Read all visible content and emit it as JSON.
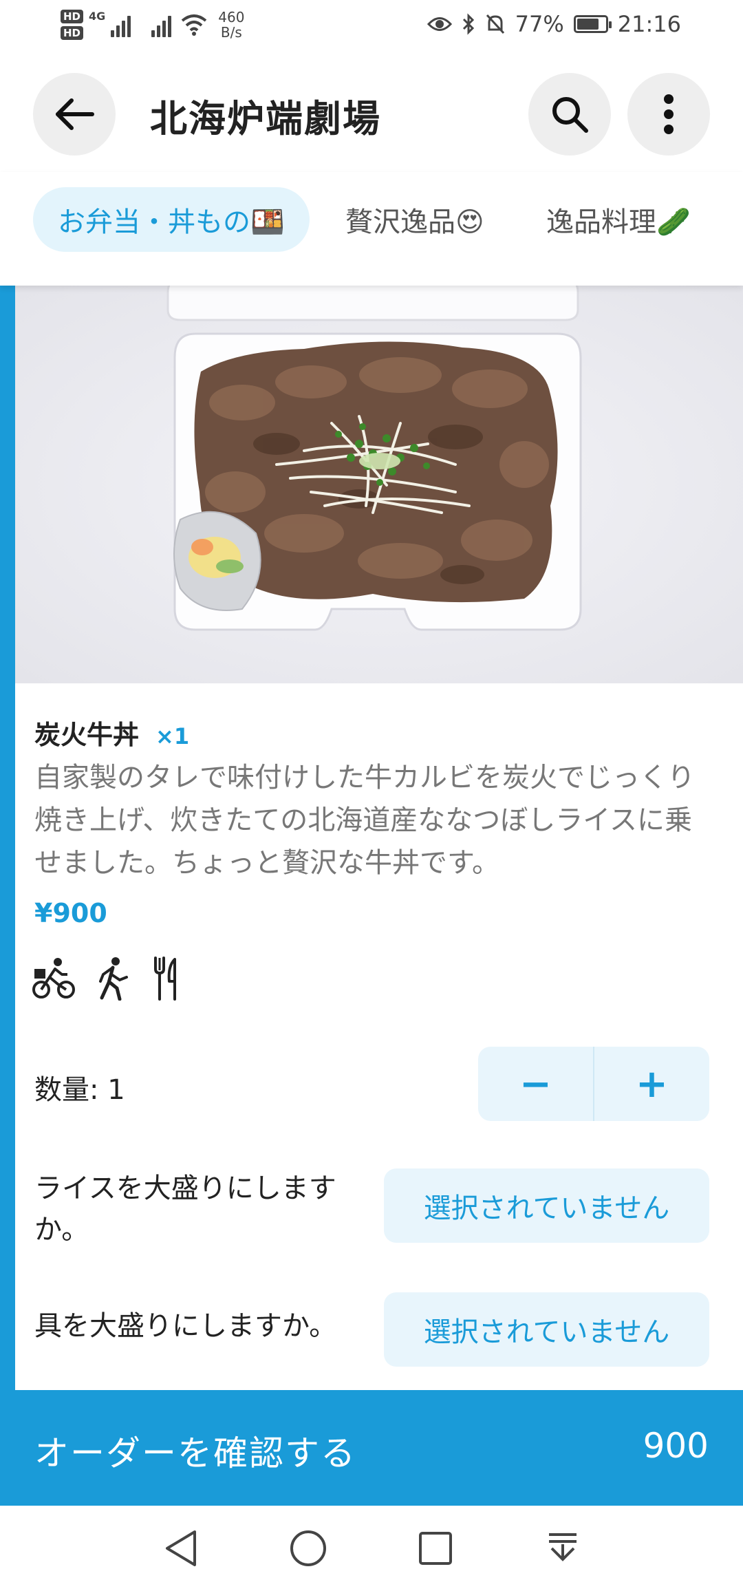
{
  "status_bar": {
    "hd1": "HD",
    "hd2": "HD",
    "network_type": "4G",
    "net_speed_value": "460",
    "net_speed_unit": "B/s",
    "battery_percent": "77%",
    "battery_level": 0.77,
    "time": "21:16"
  },
  "header": {
    "title": "北海炉端劇場"
  },
  "tabs": [
    {
      "label": "お弁当・丼もの🍱",
      "active": true
    },
    {
      "label": "贅沢逸品😍",
      "active": false
    },
    {
      "label": "逸品料理🥒",
      "active": false
    }
  ],
  "item": {
    "name": "炭火牛丼",
    "quantity_badge": "×1",
    "description": "自家製のタレで味付けした牛カルビを炭火でじっくり焼き上げ、炊きたての北海道産ななつぼしライスに乗せました。ちょっと贅沢な牛丼です。",
    "price": "¥900",
    "service_icons": [
      "delivery-bike-icon",
      "walking-pickup-icon",
      "dine-in-cutlery-icon"
    ]
  },
  "quantity": {
    "label": "数量: 1",
    "minus": "−",
    "plus": "+"
  },
  "options": [
    {
      "label": "ライスを大盛りにしますか。",
      "value": "選択されていません"
    },
    {
      "label": "具を大盛りにしますか。",
      "value": "選択されていません"
    }
  ],
  "confirm_bar": {
    "label": "オーダーを確認する",
    "total": "900"
  },
  "colors": {
    "accent": "#1a9bd8",
    "accent_light": "#e8f5fc",
    "text": "#222222",
    "muted_text": "#777777"
  }
}
